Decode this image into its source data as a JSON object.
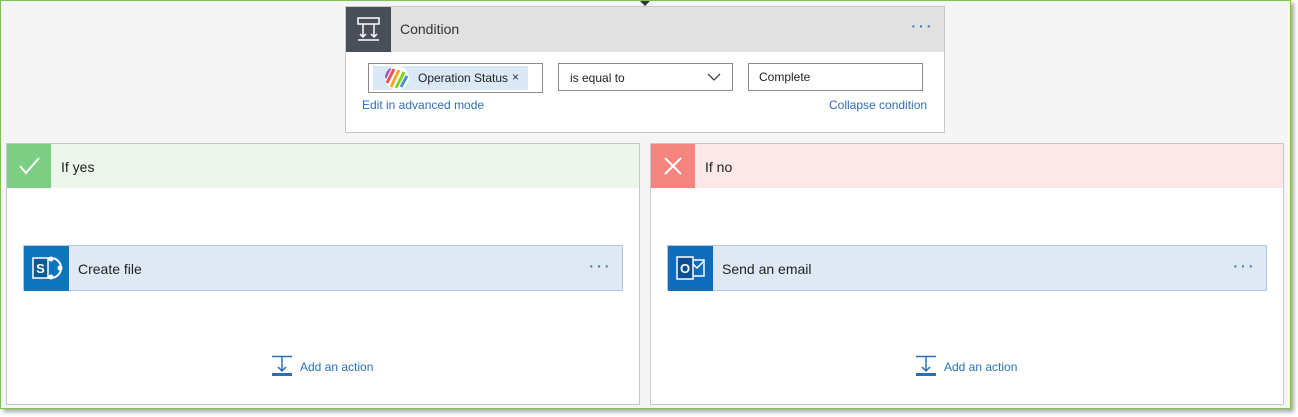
{
  "condition": {
    "title": "Condition",
    "more_label": "···",
    "token": {
      "label": "Operation Status",
      "remove": "×"
    },
    "operator": "is equal to",
    "value": "Complete",
    "advanced_link": "Edit in advanced mode",
    "collapse_link": "Collapse condition"
  },
  "yes_branch": {
    "title": "If yes",
    "action": {
      "title": "Create file",
      "more_label": "···",
      "icon": "sharepoint-icon"
    },
    "add_action": "Add an action"
  },
  "no_branch": {
    "title": "If no",
    "action": {
      "title": "Send an email",
      "more_label": "···",
      "icon": "outlook-icon"
    },
    "add_action": "Add an action"
  },
  "colors": {
    "frame_border": "#7dc452",
    "link": "#2a6fb8",
    "yes_accent": "#7dce82",
    "no_accent": "#f4847e",
    "action_bg": "#dfe9f5"
  }
}
